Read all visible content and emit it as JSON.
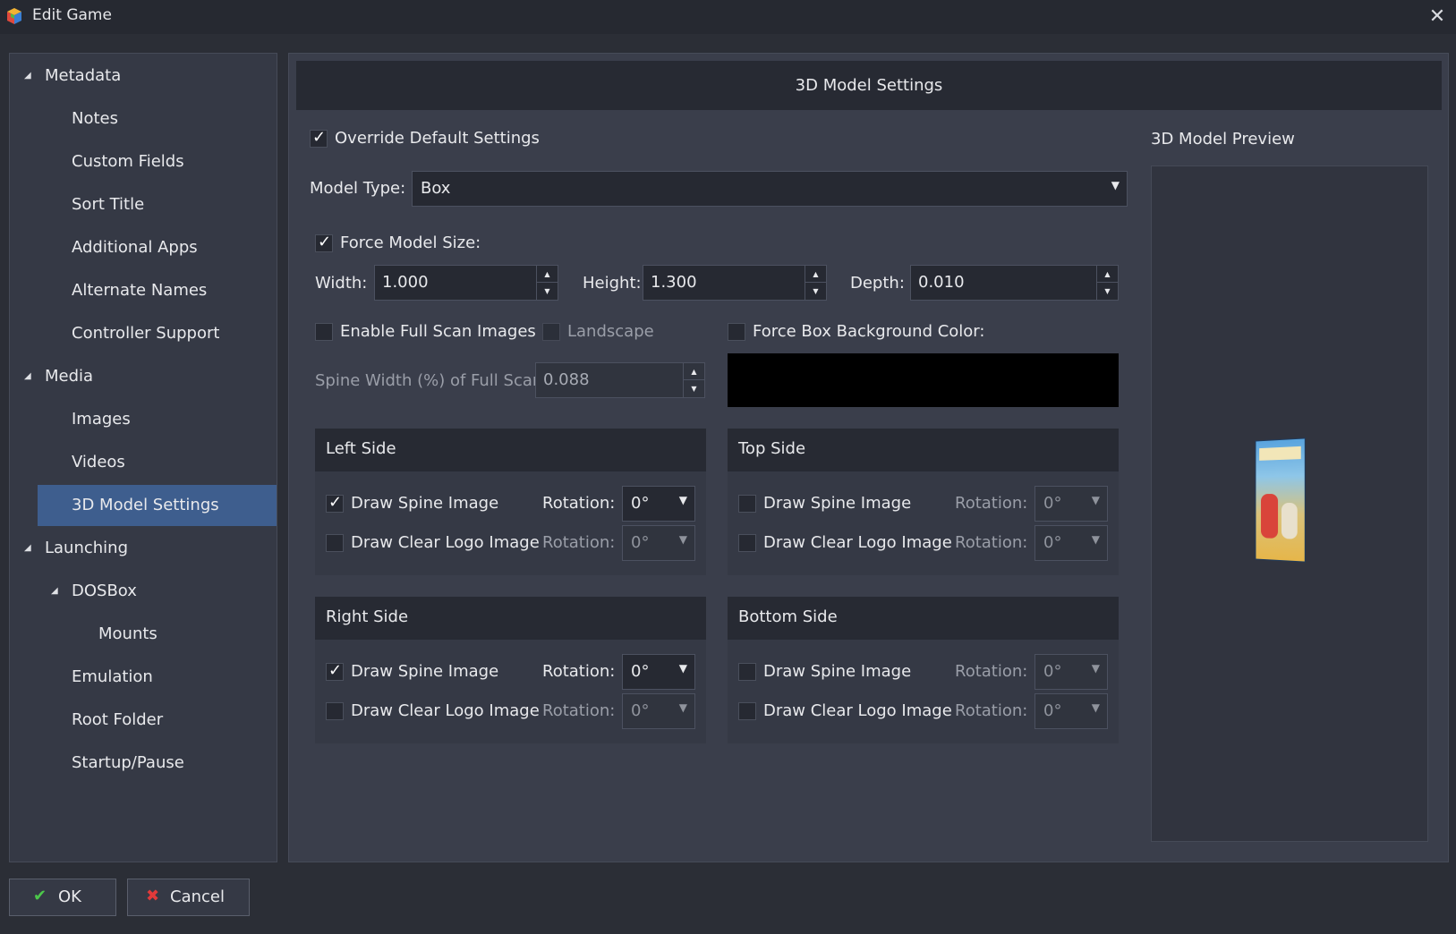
{
  "window": {
    "title": "Edit Game",
    "close_glyph": "✕",
    "app_icon": "launchbox-cube-icon"
  },
  "sidebar": {
    "items": [
      {
        "label": "Metadata",
        "expanded": true
      },
      {
        "label": "Notes"
      },
      {
        "label": "Custom Fields"
      },
      {
        "label": "Sort Title"
      },
      {
        "label": "Additional Apps"
      },
      {
        "label": "Alternate Names"
      },
      {
        "label": "Controller Support"
      },
      {
        "label": "Media",
        "expanded": true
      },
      {
        "label": "Images"
      },
      {
        "label": "Videos"
      },
      {
        "label": "3D Model Settings",
        "selected": true
      },
      {
        "label": "Launching",
        "expanded": true
      },
      {
        "label": "DOSBox",
        "expanded": true
      },
      {
        "label": "Mounts"
      },
      {
        "label": "Emulation"
      },
      {
        "label": "Root Folder"
      },
      {
        "label": "Startup/Pause"
      }
    ]
  },
  "main": {
    "header": "3D Model Settings",
    "override_label": "Override Default Settings",
    "override_checked": true,
    "model_type_label": "Model Type:",
    "model_type_value": "Box",
    "force_size_label": "Force Model Size:",
    "force_size_checked": true,
    "width_label": "Width:",
    "width_value": "1.000",
    "height_label": "Height:",
    "height_value": "1.300",
    "depth_label": "Depth:",
    "depth_value": "0.010",
    "full_scan_label": "Enable Full Scan Images",
    "full_scan_checked": false,
    "landscape_label": "Landscape",
    "landscape_checked": false,
    "force_bg_label": "Force Box Background Color:",
    "force_bg_checked": false,
    "bg_color": "#000000",
    "spine_width_label": "Spine Width (%) of Full Scan:",
    "spine_width_value": "0.088",
    "sides": [
      {
        "title": "Left Side",
        "spine_label": "Draw Spine Image",
        "spine_checked": true,
        "spine_rotation": "0°",
        "logo_label": "Draw Clear Logo Image",
        "logo_checked": false,
        "logo_rotation": "0°",
        "rotation_label": "Rotation:"
      },
      {
        "title": "Top Side",
        "spine_label": "Draw Spine Image",
        "spine_checked": false,
        "spine_rotation": "0°",
        "logo_label": "Draw Clear Logo Image",
        "logo_checked": false,
        "logo_rotation": "0°",
        "rotation_label": "Rotation:"
      },
      {
        "title": "Right Side",
        "spine_label": "Draw Spine Image",
        "spine_checked": true,
        "spine_rotation": "0°",
        "logo_label": "Draw Clear Logo Image",
        "logo_checked": false,
        "logo_rotation": "0°",
        "rotation_label": "Rotation:"
      },
      {
        "title": "Bottom Side",
        "spine_label": "Draw Spine Image",
        "spine_checked": false,
        "spine_rotation": "0°",
        "logo_label": "Draw Clear Logo Image",
        "logo_checked": false,
        "logo_rotation": "0°",
        "rotation_label": "Rotation:"
      }
    ],
    "preview_title": "3D Model Preview"
  },
  "footer": {
    "ok_label": "OK",
    "cancel_label": "Cancel"
  },
  "colors": {
    "background": "#2b2e36",
    "panel": "#3a3e4b",
    "selected": "#3e5e8e",
    "ok_check": "#4cc84a",
    "cancel_x": "#e03a3a"
  }
}
